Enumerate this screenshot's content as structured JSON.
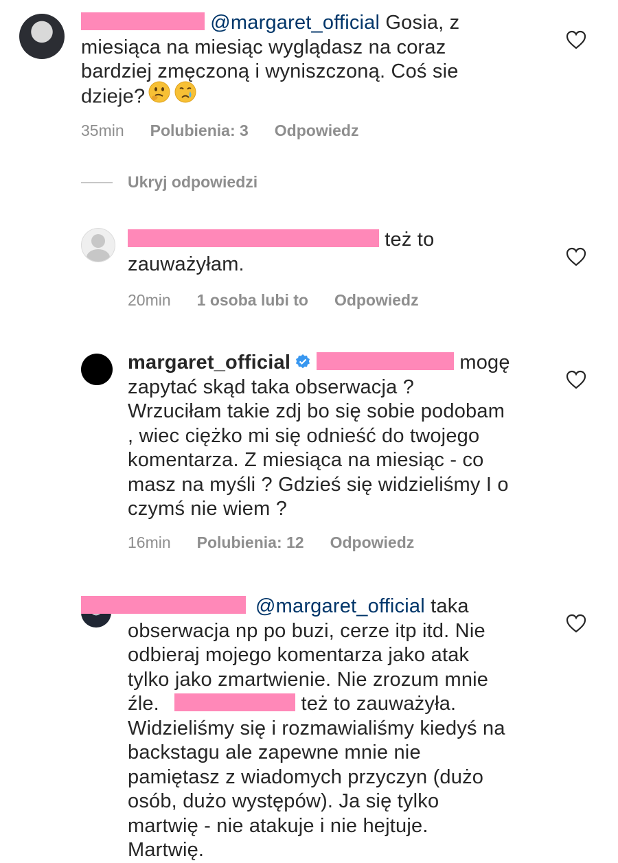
{
  "comments": [
    {
      "mention": "@margaret_official",
      "line1_rest": " Gosia, z",
      "line2": "miesiąca na miesiąc wyglądasz na coraz",
      "line3": "bardziej zmęczoną i wyniszczoną. Coś sie",
      "line4": "dzieje?",
      "time": "35min",
      "likes": "Polubienia: 3",
      "reply": "Odpowiedz"
    },
    {
      "line1_rest": "też to",
      "line2": "zauważyłam.",
      "time": "20min",
      "likes": "1 osoba lubi to",
      "reply": "Odpowiedz"
    },
    {
      "username": "margaret_official",
      "line1_rest": "mogę",
      "lines": [
        "zapytać skąd taka obserwacja ?",
        "Wrzuciłam takie zdj bo się sobie podobam",
        ", wiec ciężko mi się odnieść do twojego",
        "komentarza. Z miesiąca na miesiąc - co",
        "masz na myśli ? Gdzieś się widzieliśmy I o",
        "czymś nie wiem ?"
      ],
      "time": "16min",
      "likes": "Polubienia: 12",
      "reply": "Odpowiedz"
    },
    {
      "mention": "@margaret_official",
      "line1_rest": " taka",
      "lines": [
        "obserwacja np po buzi, cerze itp itd. Nie",
        "odbieraj mojego komentarza jako atak",
        "tylko jako zmartwienie. Nie zrozum mnie"
      ],
      "line5_start": "źle.",
      "line5_rest": "też to zauważyła.",
      "lines_after": [
        "Widzieliśmy się i rozmawialiśmy kiedyś na",
        "backstagu ale zapewne mnie nie",
        "pamiętasz z wiadomych przyczyn (dużo",
        "osób, dużo występów). Ja się tylko",
        "martwię - nie atakuje i nie hejtuje.",
        "Martwię."
      ]
    }
  ],
  "hide_replies": "Ukryj odpowiedzi",
  "icons": {
    "like": "heart-outline-icon",
    "verified": "verified-badge-icon"
  },
  "colors": {
    "redaction": "#ff88b8",
    "mention": "#003569",
    "meta": "#8e8e8e",
    "verified": "#3897f0"
  }
}
